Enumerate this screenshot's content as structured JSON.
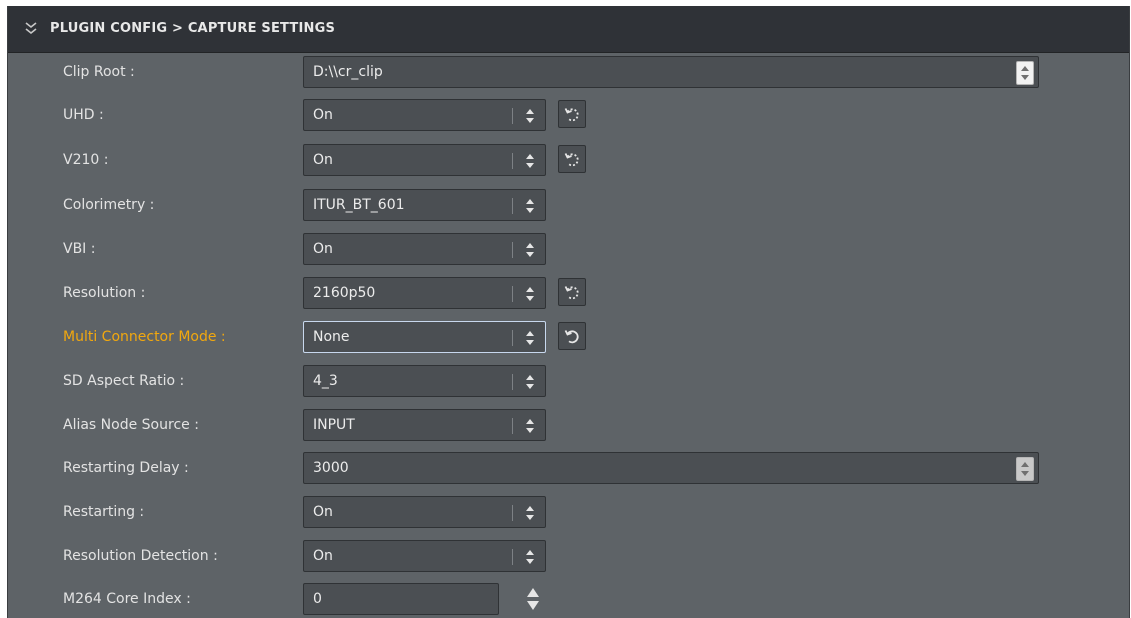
{
  "header": {
    "title": "PLUGIN CONFIG > CAPTURE SETTINGS",
    "icon": "double-chevron-down-icon"
  },
  "rows": [
    {
      "label": "Clip Root :",
      "value": "D:\\\\cr_clip",
      "control": "text-spinner"
    },
    {
      "label": "UHD :",
      "value": "On",
      "control": "dropdown",
      "reset": "dotted-reset-icon"
    },
    {
      "label": "V210 :",
      "value": "On",
      "control": "dropdown",
      "reset": "dotted-reset-icon"
    },
    {
      "label": "Colorimetry :",
      "value": "ITUR_BT_601",
      "control": "dropdown"
    },
    {
      "label": "VBI :",
      "value": "On",
      "control": "dropdown"
    },
    {
      "label": "Resolution :",
      "value": "2160p50",
      "control": "dropdown",
      "reset": "dotted-reset-icon"
    },
    {
      "label": "Multi Connector Mode :",
      "value": "None",
      "control": "dropdown",
      "reset": "undo-icon",
      "highlight": true
    },
    {
      "label": "SD Aspect Ratio :",
      "value": "4_3",
      "control": "dropdown"
    },
    {
      "label": "Alias Node Source :",
      "value": "INPUT",
      "control": "dropdown"
    },
    {
      "label": "Restarting Delay :",
      "value": "3000",
      "control": "text-spinner"
    },
    {
      "label": "Restarting :",
      "value": "On",
      "control": "dropdown"
    },
    {
      "label": "Resolution Detection :",
      "value": "On",
      "control": "dropdown"
    },
    {
      "label": "M264 Core Index :",
      "value": "0",
      "control": "number-input"
    }
  ],
  "colors": {
    "panel": "#5e6367",
    "header": "#2f3237",
    "field": "#4b4f53",
    "highlight": "#f2a80e",
    "text": "#e3e3e3"
  }
}
